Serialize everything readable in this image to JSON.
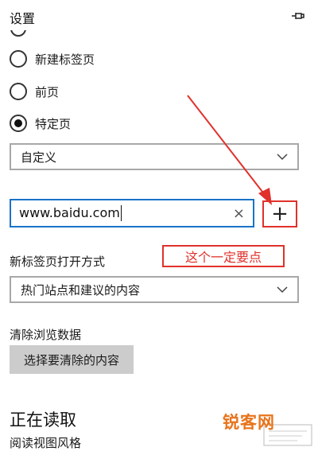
{
  "header": {
    "title": "设置",
    "pin_icon": "pin-icon"
  },
  "startup": {
    "options": [
      {
        "label": "新建标签页",
        "checked": false
      },
      {
        "label": "前页",
        "checked": false
      },
      {
        "label": "特定页",
        "checked": true
      }
    ],
    "dropdown_value": "自定义"
  },
  "url_field": {
    "value": "www.baidu.com"
  },
  "add_button": {
    "label": "+"
  },
  "annotation": {
    "text": "这个一定要点",
    "color": "#e0312b"
  },
  "new_tab": {
    "label": "新标签页打开方式",
    "dropdown_value": "热门站点和建议的内容"
  },
  "clear_data": {
    "label": "清除浏览数据",
    "button": "选择要清除的内容"
  },
  "reading": {
    "title": "正在读取",
    "subtitle": "阅读视图风格"
  },
  "watermark": {
    "text": "锐客网",
    "color": "#e8741b"
  },
  "colors": {
    "accent_blue": "#1a73c8",
    "annotation_red": "#e0312b",
    "button_gray": "#cccccc"
  }
}
